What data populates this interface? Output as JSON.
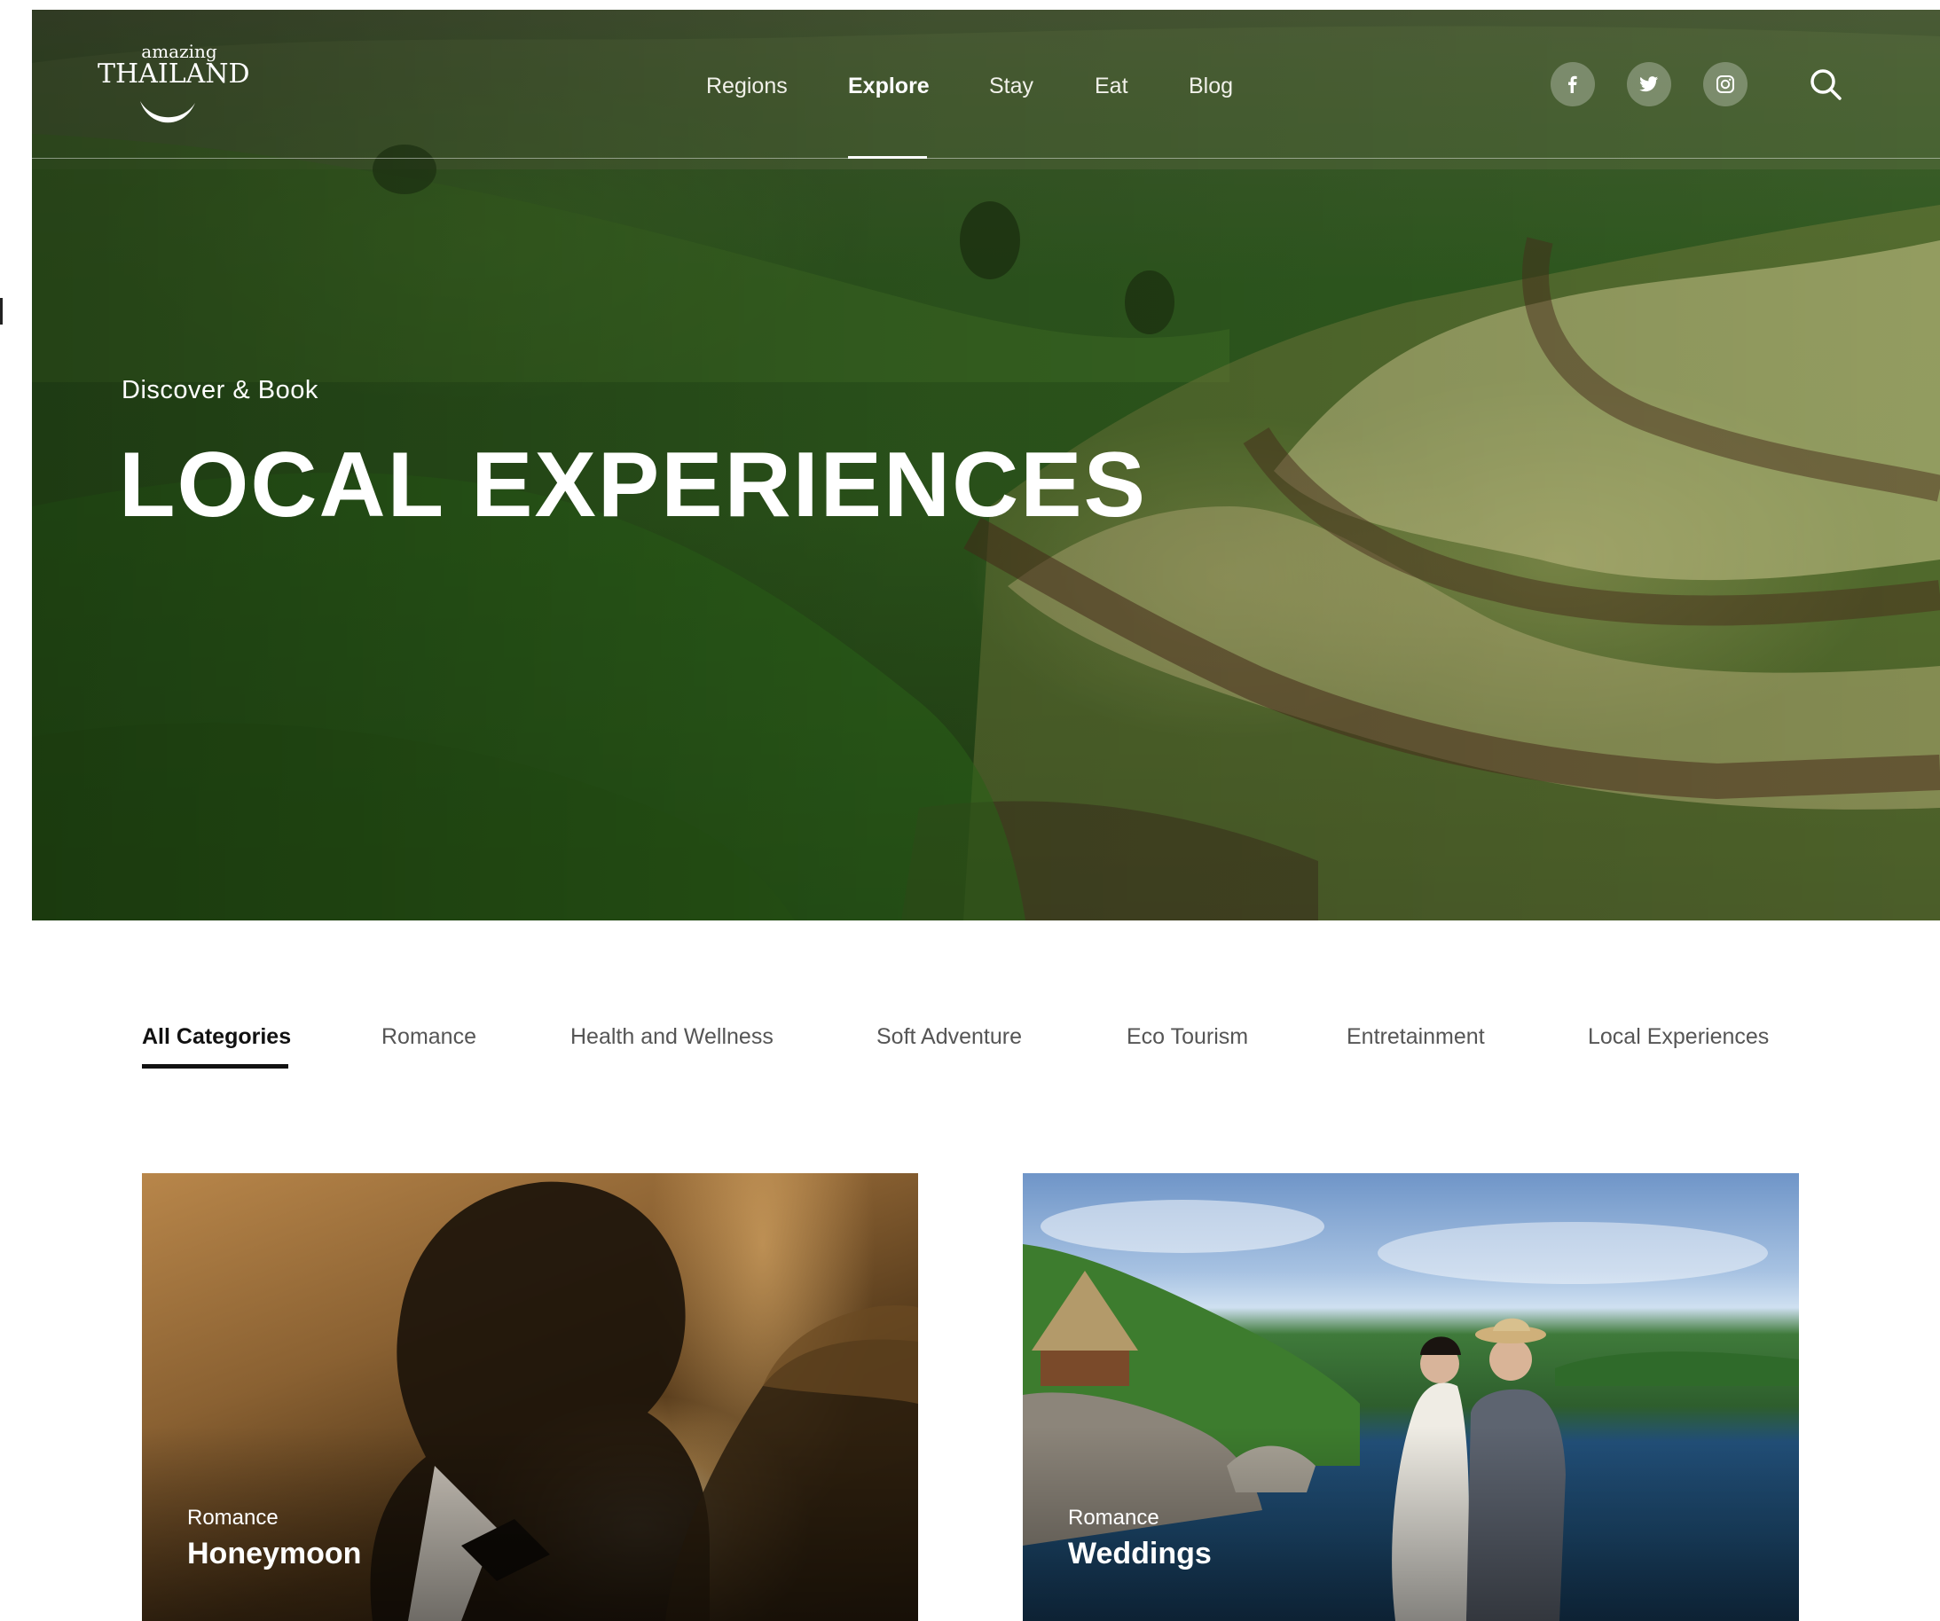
{
  "brand": {
    "logo_small": "amazing",
    "logo_big": "THAILAND"
  },
  "nav": {
    "items": [
      {
        "label": "Regions"
      },
      {
        "label": "Explore",
        "active": true
      },
      {
        "label": "Stay"
      },
      {
        "label": "Eat"
      },
      {
        "label": "Blog"
      }
    ],
    "social": [
      "facebook-icon",
      "twitter-icon",
      "instagram-icon"
    ],
    "search_icon": "search-icon"
  },
  "hero": {
    "kicker": "Discover & Book",
    "title": "LOCAL EXPERIENCES"
  },
  "categories": {
    "tabs": [
      {
        "label": "All Categories",
        "active": true
      },
      {
        "label": "Romance"
      },
      {
        "label": "Health and Wellness"
      },
      {
        "label": "Soft Adventure"
      },
      {
        "label": "Eco Tourism"
      },
      {
        "label": "Entretainment"
      },
      {
        "label": "Local Experiences"
      }
    ]
  },
  "cards": [
    {
      "category": "Romance",
      "title": "Honeymoon"
    },
    {
      "category": "Romance",
      "title": "Weddings"
    }
  ],
  "colors": {
    "hero_green": "#2e5a1c",
    "text_white": "#ffffff",
    "tab_active": "#111111",
    "tab_inactive": "#555555"
  }
}
